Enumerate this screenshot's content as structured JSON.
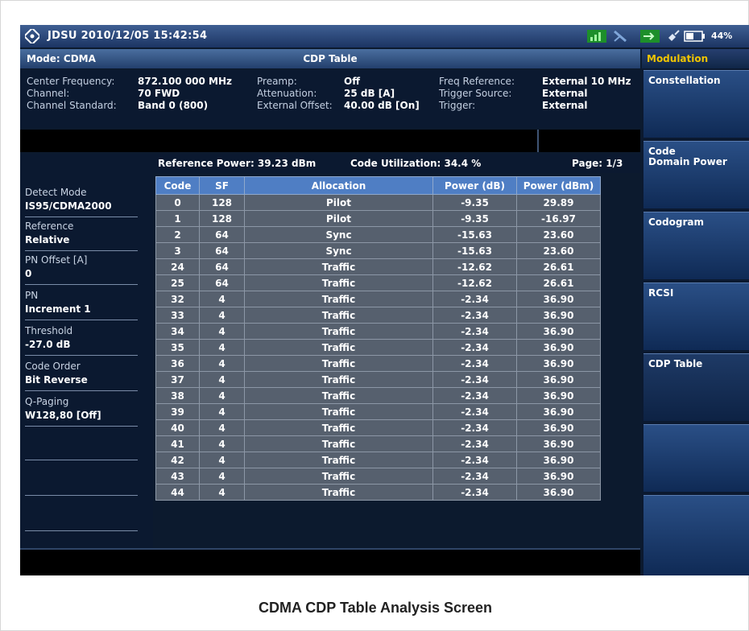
{
  "titlebar": {
    "title": "JDSU  2010/12/05 15:42:54",
    "battery": "44%",
    "icons": [
      "signal-icon",
      "antenna-icon",
      "input-icon",
      "power-plug-icon",
      "battery-icon"
    ]
  },
  "modebar": {
    "mode": "Mode: CDMA",
    "title": "CDP Table"
  },
  "info": {
    "col1_labels": [
      "Center Frequency:",
      "Channel:",
      "Channel Standard:"
    ],
    "col1_values": [
      "872.100 000 MHz",
      "70 FWD",
      "Band 0 (800)"
    ],
    "col2_labels": [
      "Preamp:",
      "Attenuation:",
      "External Offset:"
    ],
    "col2_values": [
      "Off",
      "25 dB  [A]",
      "40.00 dB  [On]"
    ],
    "col3_labels": [
      "Freq Reference:",
      "Trigger Source:",
      "Trigger:"
    ],
    "col3_values": [
      "External 10 MHz",
      "External",
      "External"
    ]
  },
  "left": {
    "params": [
      {
        "label": "Detect Mode",
        "value": "IS95/CDMA2000"
      },
      {
        "label": "Reference",
        "value": "Relative"
      },
      {
        "label": "PN Offset [A]",
        "value": "0"
      },
      {
        "label": "PN",
        "value": "Increment 1"
      },
      {
        "label": "Threshold",
        "value": "-27.0 dB"
      },
      {
        "label": "Code Order",
        "value": "Bit Reverse"
      },
      {
        "label": "Q-Paging",
        "value": "W128,80 [Off]"
      }
    ]
  },
  "summary": {
    "reference_power": "Reference Power: 39.23 dBm",
    "code_utilization": "Code Utilization: 34.4 %",
    "page": "Page:  1/3"
  },
  "table": {
    "headers": [
      "Code",
      "SF",
      "Allocation",
      "Power (dB)",
      "Power (dBm)"
    ],
    "rows": [
      [
        "0",
        "128",
        "Pilot",
        "-9.35",
        "29.89"
      ],
      [
        "1",
        "128",
        "Pilot",
        "-9.35",
        "-16.97"
      ],
      [
        "2",
        "64",
        "Sync",
        "-15.63",
        "23.60"
      ],
      [
        "3",
        "64",
        "Sync",
        "-15.63",
        "23.60"
      ],
      [
        "24",
        "64",
        "Traffic",
        "-12.62",
        "26.61"
      ],
      [
        "25",
        "64",
        "Traffic",
        "-12.62",
        "26.61"
      ],
      [
        "32",
        "4",
        "Traffic",
        "-2.34",
        "36.90"
      ],
      [
        "33",
        "4",
        "Traffic",
        "-2.34",
        "36.90"
      ],
      [
        "34",
        "4",
        "Traffic",
        "-2.34",
        "36.90"
      ],
      [
        "35",
        "4",
        "Traffic",
        "-2.34",
        "36.90"
      ],
      [
        "36",
        "4",
        "Traffic",
        "-2.34",
        "36.90"
      ],
      [
        "37",
        "4",
        "Traffic",
        "-2.34",
        "36.90"
      ],
      [
        "38",
        "4",
        "Traffic",
        "-2.34",
        "36.90"
      ],
      [
        "39",
        "4",
        "Traffic",
        "-2.34",
        "36.90"
      ],
      [
        "40",
        "4",
        "Traffic",
        "-2.34",
        "36.90"
      ],
      [
        "41",
        "4",
        "Traffic",
        "-2.34",
        "36.90"
      ],
      [
        "42",
        "4",
        "Traffic",
        "-2.34",
        "36.90"
      ],
      [
        "43",
        "4",
        "Traffic",
        "-2.34",
        "36.90"
      ],
      [
        "44",
        "4",
        "Traffic",
        "-2.34",
        "36.90"
      ]
    ]
  },
  "menu": {
    "header": "Modulation",
    "items": [
      "Constellation",
      "Code\nDomain Power",
      "Codogram",
      "RCSI",
      "CDP Table",
      "",
      ""
    ],
    "active": "CDP Table"
  },
  "caption": "CDMA CDP Table Analysis Screen",
  "colors": {
    "screen_bg": "#0c1a2e",
    "table_header": "#4f7ec4",
    "table_cell": "#56606e",
    "menu_header_text": "#f0c400"
  }
}
